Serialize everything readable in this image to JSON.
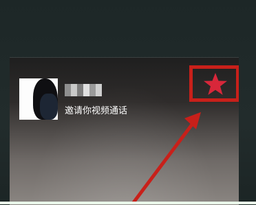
{
  "call": {
    "caller_name": "",
    "invite_text": "邀请你视频通话"
  },
  "icons": {
    "favorite": "star-icon",
    "annotation_arrow": "red-arrow"
  },
  "colors": {
    "annotation_red": "#c8201a",
    "star_fill": "#d8273a"
  }
}
